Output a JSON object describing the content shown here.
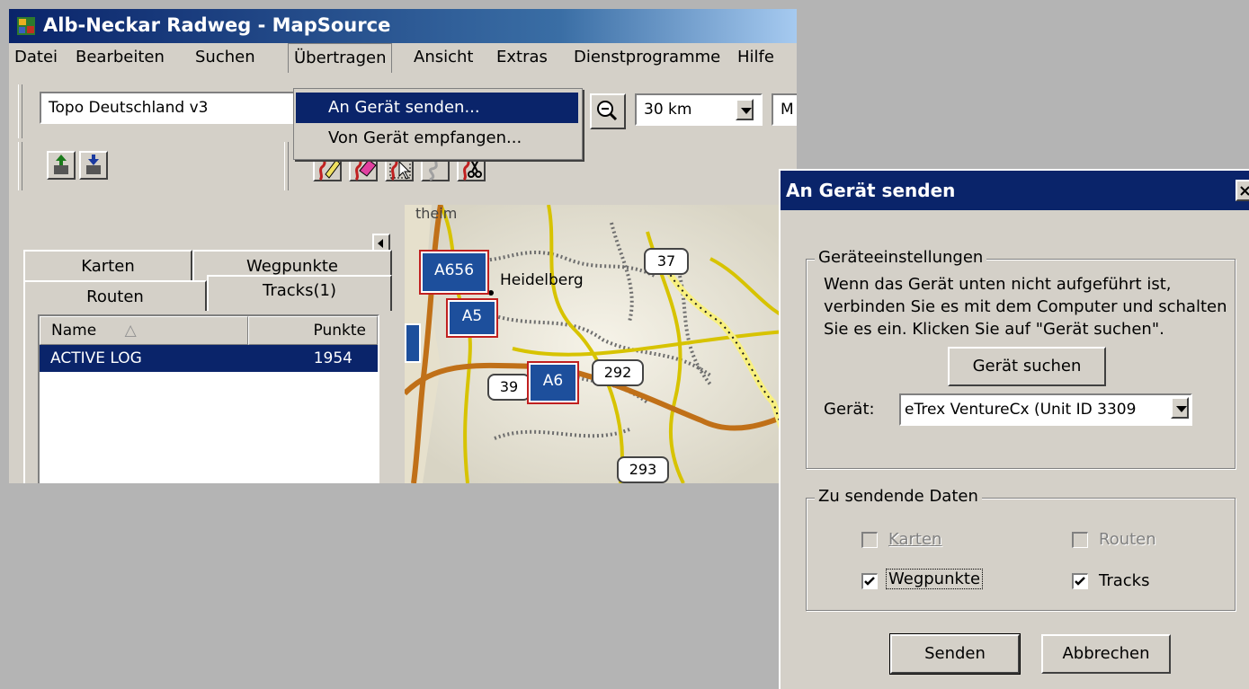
{
  "window": {
    "title": "Alb-Neckar Radweg - MapSource"
  },
  "menubar": {
    "items": [
      "Datei",
      "Bearbeiten",
      "Suchen",
      "Übertragen",
      "Ansicht",
      "Extras",
      "Dienstprogramme",
      "Hilfe"
    ]
  },
  "transfer_menu": {
    "items": [
      "An Gerät senden...",
      "Von Gerät empfangen..."
    ]
  },
  "toolbar": {
    "product": "Topo Deutschland v3",
    "zoom": "30 km",
    "partial": "M"
  },
  "tabs": {
    "karten": "Karten",
    "wegpunkte": "Wegpunkte",
    "routen": "Routen",
    "tracks": "Tracks(1)"
  },
  "tracklist": {
    "col_name": "Name",
    "sort_arrow": "△",
    "col_points": "Punkte",
    "rows": [
      {
        "name": "ACTIVE LOG",
        "points": "1954"
      }
    ]
  },
  "map": {
    "labels": {
      "heidelberg": "Heidelberg",
      "a656": "A656",
      "a5": "A5",
      "a6": "A6",
      "r37": "37",
      "r39": "39",
      "r292": "292",
      "r293": "293",
      "edge": "theim"
    }
  },
  "dialog": {
    "title": "An Gerät senden",
    "settings_group": "Geräteeinstellungen",
    "settings_text_1": "Wenn das Gerät unten nicht aufgeführt ist,",
    "settings_text_2": "verbinden Sie es mit dem Computer und schalten",
    "settings_text_3": "Sie es ein. Klicken Sie auf \"Gerät suchen\".",
    "find_button": "Gerät suchen",
    "device_label": "Gerät:",
    "device_value": "eTrex VentureCx (Unit ID 3309",
    "data_group": "Zu sendende Daten",
    "cb_karten": "Karten",
    "cb_routen": "Routen",
    "cb_wegpunkte": "Wegpunkte",
    "cb_tracks": "Tracks",
    "send_button": "Senden",
    "cancel_button": "Abbrechen"
  }
}
